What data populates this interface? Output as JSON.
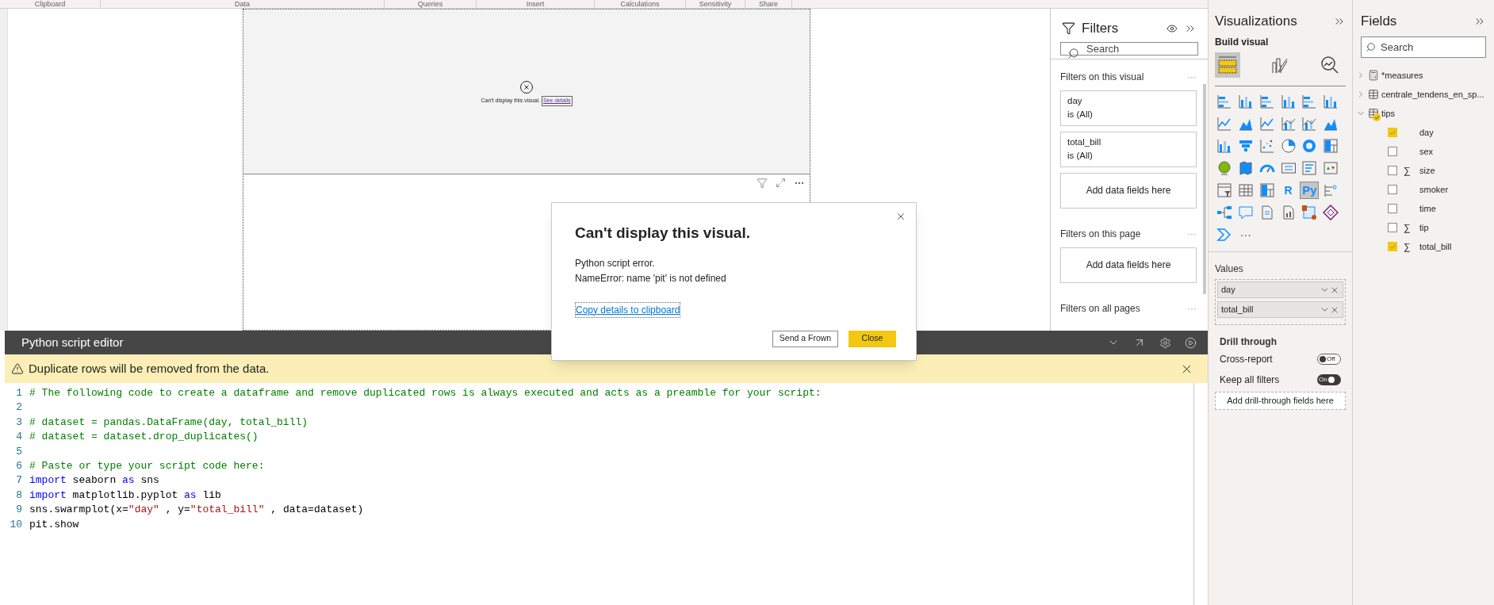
{
  "ribbon_groups": [
    "Clipboard",
    "Data",
    "Queries",
    "Insert",
    "Calculations",
    "Sensitivity",
    "Share"
  ],
  "visual": {
    "error_text": "Can't display this visual.",
    "link": "See details"
  },
  "filters": {
    "title": "Filters",
    "search_placeholder": "Search",
    "sections": [
      {
        "title": "Filters on this visual",
        "more": "···",
        "cards": [
          {
            "kind": "filter",
            "field": "day",
            "condition": "is (All)"
          },
          {
            "kind": "filter",
            "field": "total_bill",
            "condition": "is (All)"
          },
          {
            "kind": "drop",
            "label": "Add data fields here"
          }
        ]
      },
      {
        "title": "Filters on this page",
        "more": "···",
        "cards": [
          {
            "kind": "drop",
            "label": "Add data fields here"
          }
        ]
      },
      {
        "title": "Filters on all pages",
        "more": "···"
      }
    ]
  },
  "editor": {
    "title": "Python script editor",
    "warning": "Duplicate rows will be removed from the data.",
    "lines": [
      {
        "number": "1",
        "tokens": [
          {
            "kind": "comment",
            "text": "# The following code to create a dataframe and remove duplicated rows is always executed and acts as a preamble for your script:"
          }
        ]
      },
      {
        "number": "2"
      },
      {
        "number": "3",
        "tokens": [
          {
            "kind": "comment",
            "text": "# dataset = pandas.DataFrame(day, total_bill)"
          }
        ]
      },
      {
        "number": "4",
        "tokens": [
          {
            "kind": "comment",
            "text": "# dataset = dataset.drop_duplicates()"
          }
        ]
      },
      {
        "number": "5"
      },
      {
        "number": "6",
        "tokens": [
          {
            "kind": "comment",
            "text": "# Paste or type your script code here:"
          }
        ]
      },
      {
        "number": "7",
        "tokens": [
          {
            "kind": "keyword",
            "text": "import"
          },
          {
            "kind": "plain",
            "text": " seaborn "
          },
          {
            "kind": "keyword",
            "text": "as"
          },
          {
            "kind": "plain",
            "text": " sns"
          }
        ]
      },
      {
        "number": "8",
        "tokens": [
          {
            "kind": "keyword",
            "text": "import"
          },
          {
            "kind": "plain",
            "text": " matplotlib.pyplot "
          },
          {
            "kind": "keyword",
            "text": "as"
          },
          {
            "kind": "plain",
            "text": " lib"
          }
        ]
      },
      {
        "number": "9",
        "tokens": [
          {
            "kind": "plain",
            "text": "sns.swarmplot(x="
          },
          {
            "kind": "string",
            "text": "\"day\""
          },
          {
            "kind": "plain",
            "text": " , y="
          },
          {
            "kind": "string",
            "text": "\"total_bill\""
          },
          {
            "kind": "plain",
            "text": " , data=dataset)"
          }
        ]
      },
      {
        "number": "10",
        "tokens": [
          {
            "kind": "plain",
            "text": "pit.show"
          }
        ]
      }
    ]
  },
  "visualizations": {
    "title": "Visualizations",
    "subtitle": "Build visual",
    "build_tabs": [
      {
        "selected": true
      },
      {
        "selected": false
      },
      {
        "selected": false
      }
    ],
    "visual_types": [
      {
        "selected": false
      },
      {
        "selected": false
      },
      {
        "selected": false
      },
      {
        "selected": false
      },
      {
        "selected": false
      },
      {
        "selected": false
      },
      {
        "selected": false
      },
      {
        "selected": false
      },
      {
        "selected": false
      },
      {
        "selected": false
      },
      {
        "selected": false
      },
      {
        "selected": false
      },
      {
        "selected": false
      },
      {
        "selected": false
      },
      {
        "selected": false
      },
      {
        "selected": false
      },
      {
        "selected": false
      },
      {
        "selected": false
      },
      {
        "selected": false
      },
      {
        "selected": false
      },
      {
        "selected": false
      },
      {
        "selected": false
      },
      {
        "selected": false
      },
      {
        "selected": false
      },
      {
        "selected": false
      },
      {
        "selected": false
      },
      {
        "selected": false
      },
      {
        "label": "R",
        "selected": false
      },
      {
        "label": "Py",
        "selected": true
      },
      {
        "selected": false
      },
      {
        "selected": false
      },
      {
        "selected": false
      },
      {
        "selected": false
      },
      {
        "selected": false
      },
      {
        "selected": false
      },
      {
        "selected": false
      },
      {
        "selected": false
      }
    ],
    "more": "···",
    "values": {
      "title": "Values",
      "items": [
        {
          "label": "day"
        },
        {
          "label": "total_bill"
        }
      ]
    },
    "drill_through": {
      "title": "Drill through",
      "toggles": [
        {
          "label": "Cross-report",
          "on": false,
          "state_text": "Off"
        },
        {
          "label": "Keep all filters",
          "on": true,
          "state_text": "On"
        }
      ],
      "drop_label": "Add drill-through fields here"
    }
  },
  "fields": {
    "title": "Fields",
    "search_placeholder": "Search",
    "tables": [
      {
        "kind": "measures",
        "name": "*measures",
        "expanded": false,
        "in_use": false
      },
      {
        "kind": "table",
        "name": "centrale_tendens_en_sp...",
        "expanded": false,
        "in_use": false
      },
      {
        "kind": "table",
        "name": "tips",
        "expanded": true,
        "in_use": true,
        "children": [
          {
            "name": "day",
            "checked": true
          },
          {
            "name": "sex",
            "checked": false
          },
          {
            "name": "size",
            "prefix": "∑",
            "checked": false
          },
          {
            "name": "smoker",
            "checked": false
          },
          {
            "name": "time",
            "checked": false
          },
          {
            "name": "tip",
            "prefix": "∑",
            "checked": false
          },
          {
            "name": "total_bill",
            "prefix": "∑",
            "checked": true
          }
        ]
      }
    ]
  },
  "dialog": {
    "title": "Can't display this visual.",
    "message_lines": [
      "Python script error.",
      "NameError: name 'pit' is not defined"
    ],
    "link": "Copy details to clipboard",
    "buttons": [
      {
        "kind": "secondary",
        "label": "Send a Frown"
      },
      {
        "kind": "primary",
        "label": "Close"
      }
    ]
  }
}
